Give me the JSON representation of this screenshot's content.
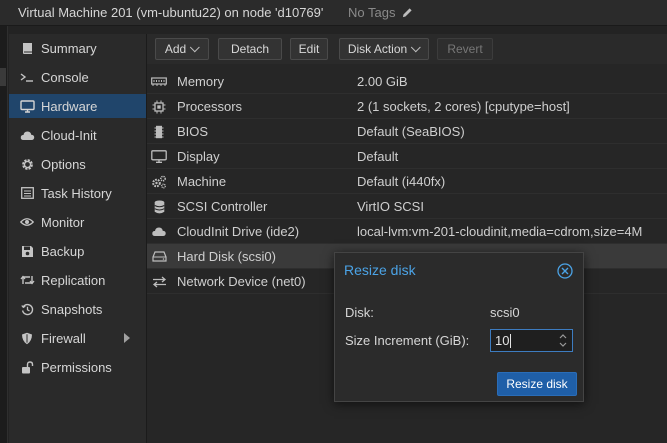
{
  "header": {
    "title": "Virtual Machine 201 (vm-ubuntu22) on node 'd10769'",
    "tags_label": "No Tags"
  },
  "sidebar": {
    "items": [
      {
        "label": "Summary",
        "icon": "book-icon",
        "active": false
      },
      {
        "label": "Console",
        "icon": "terminal-icon",
        "active": false
      },
      {
        "label": "Hardware",
        "icon": "desktop-icon",
        "active": true
      },
      {
        "label": "Cloud-Init",
        "icon": "cloud-icon",
        "active": false
      },
      {
        "label": "Options",
        "icon": "gear-icon",
        "active": false
      },
      {
        "label": "Task History",
        "icon": "list-icon",
        "active": false
      },
      {
        "label": "Monitor",
        "icon": "eye-icon",
        "active": false
      },
      {
        "label": "Backup",
        "icon": "floppy-icon",
        "active": false
      },
      {
        "label": "Replication",
        "icon": "retweet-icon",
        "active": false
      },
      {
        "label": "Snapshots",
        "icon": "history-icon",
        "active": false
      },
      {
        "label": "Firewall",
        "icon": "shield-icon",
        "active": false
      },
      {
        "label": "Permissions",
        "icon": "unlock-icon",
        "active": false
      }
    ]
  },
  "toolbar": {
    "add": "Add",
    "detach": "Detach",
    "edit": "Edit",
    "disk_action": "Disk Action",
    "revert": "Revert"
  },
  "hardware": {
    "rows": [
      {
        "name": "Memory",
        "value": "2.00 GiB",
        "icon": "memory-icon"
      },
      {
        "name": "Processors",
        "value": "2 (1 sockets, 2 cores) [cputype=host]",
        "icon": "cpu-icon"
      },
      {
        "name": "BIOS",
        "value": "Default (SeaBIOS)",
        "icon": "microchip-icon"
      },
      {
        "name": "Display",
        "value": "Default",
        "icon": "display-icon"
      },
      {
        "name": "Machine",
        "value": "Default (i440fx)",
        "icon": "cogs-icon"
      },
      {
        "name": "SCSI Controller",
        "value": "VirtIO SCSI",
        "icon": "database-icon"
      },
      {
        "name": "CloudInit Drive (ide2)",
        "value": "local-lvm:vm-201-cloudinit,media=cdrom,size=4M",
        "icon": "cloud-icon"
      },
      {
        "name": "Hard Disk (scsi0)",
        "value": "",
        "icon": "hdd-icon"
      },
      {
        "name": "Network Device (net0)",
        "value": "",
        "icon": "exchange-icon"
      }
    ],
    "selected_index": 7
  },
  "dialog": {
    "title": "Resize disk",
    "disk_label": "Disk:",
    "disk_value": "scsi0",
    "size_label": "Size Increment (GiB):",
    "size_value": "10",
    "submit": "Resize disk"
  },
  "colors": {
    "accent": "#4ba3e6",
    "active_nav": "#20456b",
    "primary_button": "#1f5fa8"
  }
}
